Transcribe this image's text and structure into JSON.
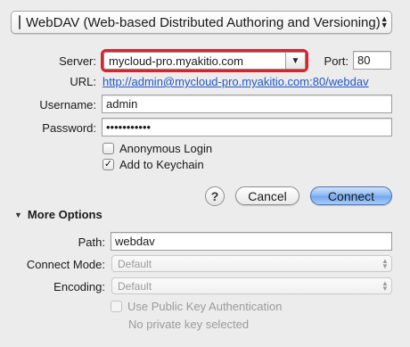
{
  "protocol": {
    "label": "WebDAV (Web-based Distributed Authoring and Versioning)"
  },
  "server": {
    "label": "Server:",
    "value": "mycloud-pro.myakitio.com"
  },
  "port": {
    "label": "Port:",
    "value": "80"
  },
  "url": {
    "label": "URL:",
    "value": "http://admin@mycloud-pro.myakitio.com:80/webdav"
  },
  "username": {
    "label": "Username:",
    "value": "admin"
  },
  "password": {
    "label": "Password:",
    "value": "•••••••••••"
  },
  "options": {
    "anonymous": {
      "label": "Anonymous Login",
      "checked": false
    },
    "keychain": {
      "label": "Add to Keychain",
      "checked": true
    }
  },
  "buttons": {
    "help": "?",
    "cancel": "Cancel",
    "connect": "Connect"
  },
  "more_options": {
    "title": "More Options",
    "path": {
      "label": "Path:",
      "value": "webdav"
    },
    "connect_mode": {
      "label": "Connect Mode:",
      "value": "Default"
    },
    "encoding": {
      "label": "Encoding:",
      "value": "Default"
    },
    "public_key": {
      "label": "Use Public Key Authentication",
      "checked": false
    },
    "private_key_status": "No private key selected"
  },
  "colors": {
    "focus_ring": "#d6262c",
    "link": "#2156c8",
    "primary_button": "#6ea6ef"
  }
}
